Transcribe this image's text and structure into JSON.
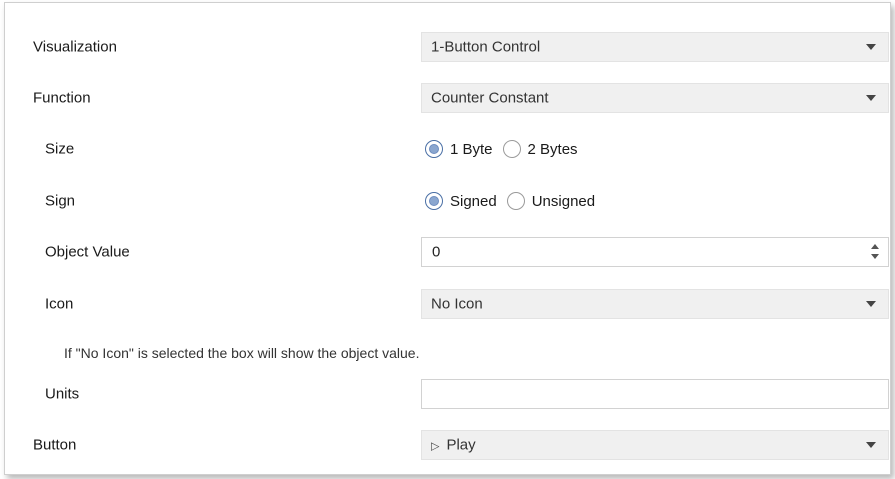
{
  "visualization": {
    "label": "Visualization",
    "value": "1-Button Control"
  },
  "function": {
    "label": "Function",
    "value": "Counter Constant"
  },
  "size": {
    "label": "Size",
    "options": [
      "1 Byte",
      "2 Bytes"
    ],
    "selected": "1 Byte"
  },
  "sign": {
    "label": "Sign",
    "options": [
      "Signed",
      "Unsigned"
    ],
    "selected": "Signed"
  },
  "object_value": {
    "label": "Object Value",
    "value": "0"
  },
  "icon": {
    "label": "Icon",
    "value": "No Icon"
  },
  "note": "If \"No Icon\" is selected the box will show the object value.",
  "units": {
    "label": "Units",
    "value": ""
  },
  "button": {
    "label": "Button",
    "icon": "play-icon",
    "value": "Play"
  },
  "colors": {
    "selected_radio": "#8aa6cf",
    "select_bg": "#f0f0f0"
  }
}
